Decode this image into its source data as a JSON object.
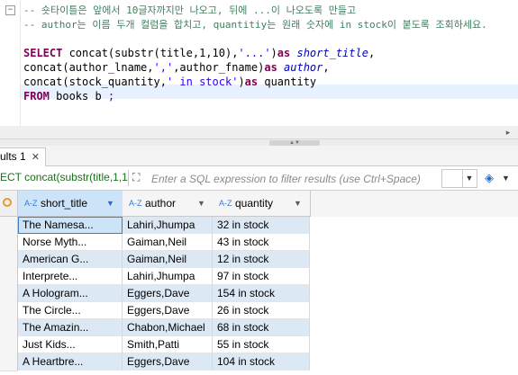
{
  "editor": {
    "lines": [
      {
        "segments": [
          {
            "cls": "cmt",
            "text": "-- 숏타이틀은 앞에서 10글자까지만 나오고, 뒤에 ...이 나오도록 만들고"
          }
        ]
      },
      {
        "segments": [
          {
            "cls": "cmt",
            "text": "-- author는 이름 두개 컬럼을 합치고, quantitiy는 원래 숫자에 in stock이 붙도록 조회하세요."
          }
        ]
      },
      {
        "segments": []
      },
      {
        "segments": [
          {
            "cls": "kw",
            "text": "SELECT "
          },
          {
            "cls": "fn",
            "text": "concat(substr(title,1,10),"
          },
          {
            "cls": "str",
            "text": "'...'"
          },
          {
            "cls": "fn",
            "text": ")"
          },
          {
            "cls": "kw",
            "text": "as "
          },
          {
            "cls": "alias",
            "text": "short_title"
          },
          {
            "cls": "fn",
            "text": ","
          }
        ]
      },
      {
        "segments": [
          {
            "cls": "fn",
            "text": "concat(author_lname,"
          },
          {
            "cls": "str",
            "text": "','"
          },
          {
            "cls": "fn",
            "text": ",author_fname)"
          },
          {
            "cls": "kw",
            "text": "as "
          },
          {
            "cls": "alias",
            "text": "author"
          },
          {
            "cls": "fn",
            "text": ","
          }
        ]
      },
      {
        "segments": [
          {
            "cls": "fn",
            "text": "concat(stock_quantity,"
          },
          {
            "cls": "str",
            "text": "' in stock'"
          },
          {
            "cls": "fn",
            "text": ")"
          },
          {
            "cls": "kw",
            "text": "as "
          },
          {
            "cls": "fn",
            "text": "quantity"
          }
        ]
      },
      {
        "segments": [
          {
            "cls": "kw",
            "text": "FROM "
          },
          {
            "cls": "fn",
            "text": "books b "
          },
          {
            "cls": "str",
            "text": ";"
          }
        ]
      }
    ],
    "fold_marker": "−"
  },
  "results": {
    "tab_label": "ults 1",
    "tab_close": "✕",
    "sql_prefix": "ECT concat(substr(title,1,1",
    "filter_placeholder": "Enter a SQL expression to filter results (use Ctrl+Space)",
    "columns": [
      {
        "type": "A-Z",
        "name": "short_title",
        "active": true
      },
      {
        "type": "A-Z",
        "name": "author",
        "active": false
      },
      {
        "type": "A-Z",
        "name": "quantity",
        "active": false
      }
    ],
    "rows": [
      {
        "short_title": "The Namesa...",
        "author": "Lahiri,Jhumpa",
        "quantity": "32 in stock"
      },
      {
        "short_title": "Norse Myth...",
        "author": "Gaiman,Neil",
        "quantity": "43 in stock"
      },
      {
        "short_title": "American G...",
        "author": "Gaiman,Neil",
        "quantity": "12 in stock"
      },
      {
        "short_title": "Interprete...",
        "author": "Lahiri,Jhumpa",
        "quantity": "97 in stock"
      },
      {
        "short_title": "A Hologram...",
        "author": "Eggers,Dave",
        "quantity": "154 in stock"
      },
      {
        "short_title": "The Circle...",
        "author": "Eggers,Dave",
        "quantity": "26 in stock"
      },
      {
        "short_title": "The Amazin...",
        "author": "Chabon,Michael",
        "quantity": "68 in stock"
      },
      {
        "short_title": "Just Kids...",
        "author": "Smith,Patti",
        "quantity": "55 in stock"
      },
      {
        "short_title": "A Heartbre...",
        "author": "Eggers,Dave",
        "quantity": "104 in stock"
      }
    ],
    "selected_row": 0,
    "accent_color": "#3d7ec4",
    "stripe_color": "#dde8f5"
  }
}
